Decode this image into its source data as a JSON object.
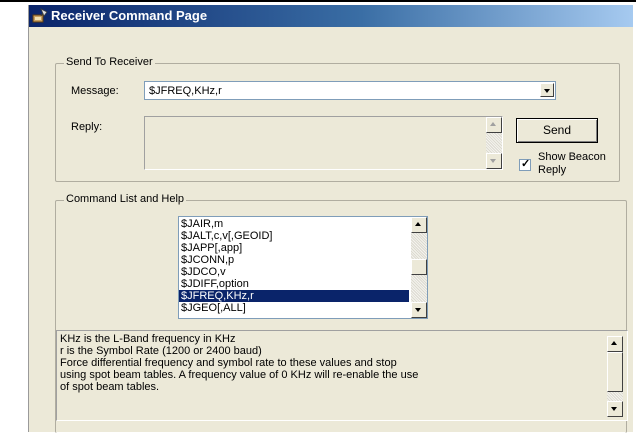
{
  "window": {
    "title": "Receiver Command Page"
  },
  "send_group": {
    "legend": "Send To Receiver",
    "message_label": "Message:",
    "message_value": "$JFREQ,KHz,r",
    "reply_label": "Reply:",
    "send_button": "Send",
    "show_beacon_label_1": "Show Beacon",
    "show_beacon_label_2": "Reply",
    "show_beacon_checked": true
  },
  "help_group": {
    "legend": "Command List and Help",
    "commands": [
      "$JAIR,m",
      "$JALT,c,v[,GEOID]",
      "$JAPP[,app]",
      "$JCONN,p",
      "$JDCO,v",
      "$JDIFF,option",
      "$JFREQ,KHz,r",
      "$JGEO[,ALL]"
    ],
    "selected_command": "$JFREQ,KHz,r",
    "help_lines": [
      "KHz is the L-Band frequency in KHz",
      "r is the Symbol Rate (1200 or 2400 baud)",
      "Force differential frequency and symbol rate to these values and stop",
      "using spot beam tables.  A frequency value of 0 KHz will re-enable the use",
      "of spot beam tables."
    ]
  },
  "colors": {
    "title_bar": "#0a246a",
    "selection": "#0a246a",
    "window_bg": "#ece9d8"
  }
}
